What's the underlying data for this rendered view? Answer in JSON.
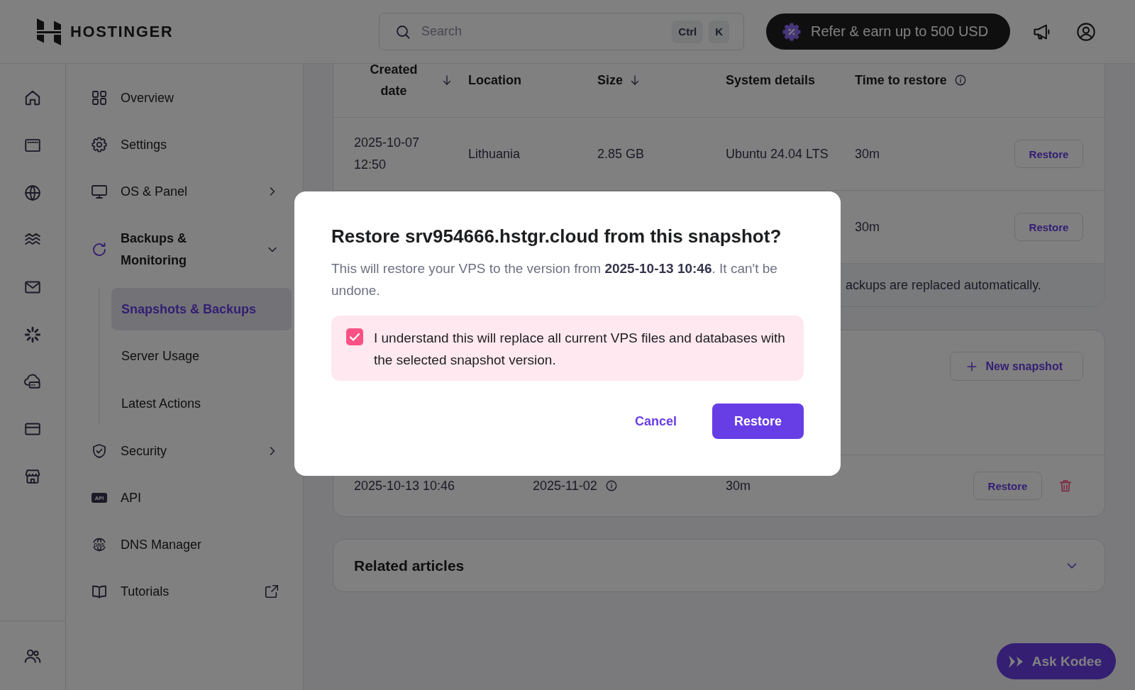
{
  "header": {
    "logo": "HOSTINGER",
    "search": {
      "placeholder": "Search",
      "keys": [
        "Ctrl",
        "K"
      ]
    },
    "refer_button": "Refer & earn up to 500 USD"
  },
  "sidebar": {
    "items": [
      {
        "label": "Overview",
        "kind": "link",
        "selected": false
      },
      {
        "label": "Settings",
        "kind": "link",
        "selected": false
      },
      {
        "label": "OS & Panel",
        "kind": "group",
        "selected": false,
        "expanded": false
      },
      {
        "label": "Backups & Monitoring",
        "kind": "group",
        "selected": true,
        "expanded": true,
        "children": [
          {
            "label": "Snapshots & Backups",
            "selected": true
          },
          {
            "label": "Server Usage",
            "selected": false
          },
          {
            "label": "Latest Actions",
            "selected": false
          }
        ]
      },
      {
        "label": "Security",
        "kind": "group",
        "selected": false,
        "expanded": false
      },
      {
        "label": "API",
        "kind": "link",
        "selected": false,
        "icon_text": "API"
      },
      {
        "label": "DNS Manager",
        "kind": "link",
        "selected": false,
        "icon_text": "DNS"
      },
      {
        "label": "Tutorials",
        "kind": "external",
        "selected": false
      }
    ]
  },
  "snapshots_table": {
    "columns": [
      {
        "label": "Created date",
        "sorted": true,
        "info": false
      },
      {
        "label": "Location",
        "sorted": false,
        "info": false
      },
      {
        "label": "Size",
        "sorted": true,
        "info": false
      },
      {
        "label": "System details",
        "sorted": false,
        "info": false
      },
      {
        "label": "Time to restore",
        "sorted": false,
        "info": true
      }
    ],
    "rows": [
      {
        "created_date": "2025-10-07 12:50",
        "location": "Lithuania",
        "size": "2.85 GB",
        "system_details": "Ubuntu 24.04 LTS",
        "time_to_restore": "30m",
        "action": "Restore"
      },
      {
        "time_to_restore": "30m",
        "action": "Restore"
      }
    ],
    "note": "ackups are replaced automatically."
  },
  "backups_card": {
    "new_snapshot_button": "New snapshot",
    "rows": [
      {
        "column_1": "2025-10-13 10:46",
        "column_2": "2025-11-02",
        "column_3": "30m",
        "action": "Restore"
      }
    ]
  },
  "related_articles": {
    "title": "Related articles",
    "expanded": false
  },
  "ask_kodee_button": "Ask Kodee",
  "dialog": {
    "title": "Restore srv954666.hstgr.cloud from this snapshot?",
    "message": "This will restore your VPS to the version from **2025-10-13 10:46**. It can't be undone.",
    "confirmation": {
      "label": "I understand this will replace all current VPS files and databases with the selected snapshot version.",
      "checked": true
    },
    "buttons": [
      {
        "label": "Cancel",
        "kind": "secondary"
      },
      {
        "label": "Restore",
        "kind": "primary"
      }
    ]
  }
}
